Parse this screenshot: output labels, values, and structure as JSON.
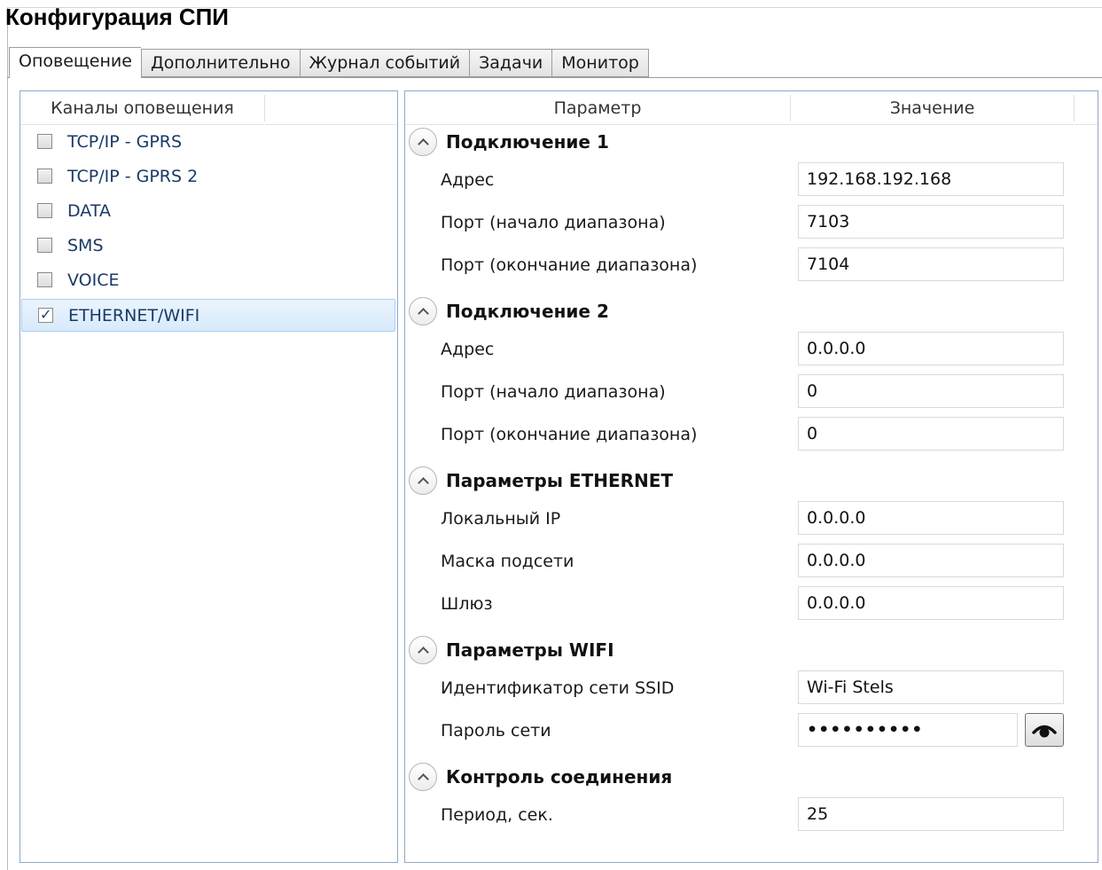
{
  "window": {
    "title": "Конфигурация СПИ"
  },
  "tabs": [
    {
      "label": "Оповещение",
      "active": true
    },
    {
      "label": "Дополнительно",
      "active": false
    },
    {
      "label": "Журнал событий",
      "active": false
    },
    {
      "label": "Задачи",
      "active": false
    },
    {
      "label": "Монитор",
      "active": false
    }
  ],
  "channels": {
    "header": "Каналы оповещения",
    "items": [
      {
        "label": "TCP/IP - GPRS",
        "checked": false
      },
      {
        "label": "TCP/IP - GPRS 2",
        "checked": false
      },
      {
        "label": "DATA",
        "checked": false
      },
      {
        "label": "SMS",
        "checked": false
      },
      {
        "label": "VOICE",
        "checked": false
      },
      {
        "label": "ETHERNET/WIFI",
        "checked": true
      }
    ]
  },
  "params": {
    "header_param": "Параметр",
    "header_value": "Значение",
    "groups": [
      {
        "title": "Подключение 1",
        "rows": [
          {
            "label": "Адрес",
            "value": "192.168.192.168"
          },
          {
            "label": "Порт (начало диапазона)",
            "value": "7103"
          },
          {
            "label": "Порт (окончание диапазона)",
            "value": "7104"
          }
        ]
      },
      {
        "title": "Подключение 2",
        "rows": [
          {
            "label": "Адрес",
            "value": "0.0.0.0"
          },
          {
            "label": "Порт (начало диапазона)",
            "value": "0"
          },
          {
            "label": "Порт (окончание диапазона)",
            "value": "0"
          }
        ]
      },
      {
        "title": "Параметры ETHERNET",
        "rows": [
          {
            "label": "Локальный IP",
            "value": "0.0.0.0"
          },
          {
            "label": "Маска подсети",
            "value": "0.0.0.0"
          },
          {
            "label": "Шлюз",
            "value": "0.0.0.0"
          }
        ]
      },
      {
        "title": "Параметры WIFI",
        "rows": [
          {
            "label": "Идентификатор сети SSID",
            "value": "Wi-Fi Stels"
          },
          {
            "label": "Пароль сети",
            "value": "••••••••••"
          }
        ]
      },
      {
        "title": "Контроль соединения",
        "rows": [
          {
            "label": "Период, сек.",
            "value": "25"
          }
        ]
      }
    ]
  },
  "icons": {
    "group_toggle": "chevron-up-icon",
    "show_password": "eye-icon"
  }
}
